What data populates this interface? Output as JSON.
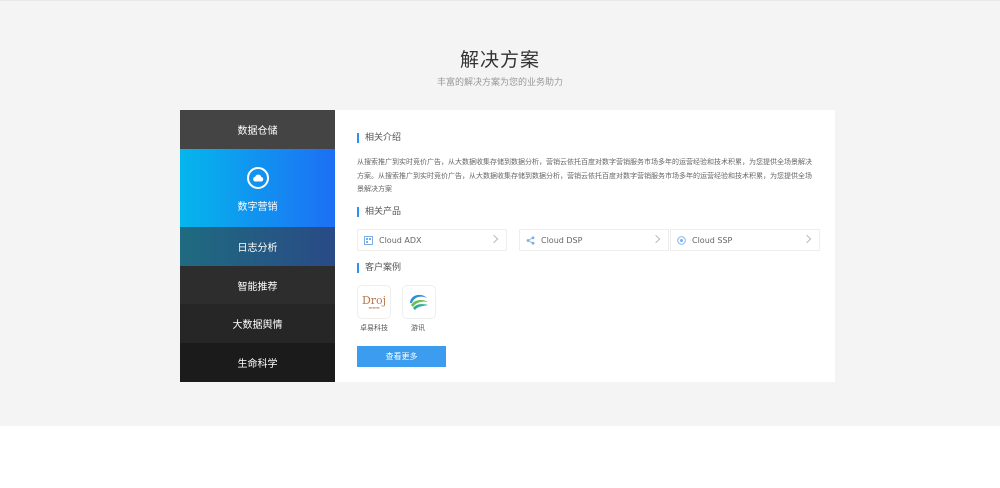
{
  "header": {
    "title": "解决方案",
    "subtitle": "丰富的解决方案为您的业务助力"
  },
  "menu": {
    "items": [
      {
        "label": "数据仓储"
      },
      {
        "label": "数字营销",
        "active": true,
        "icon": "cloud-icon"
      },
      {
        "label": "日志分析"
      },
      {
        "label": "智能推荐"
      },
      {
        "label": "大数据舆情"
      },
      {
        "label": "生命科学"
      }
    ]
  },
  "content": {
    "intro_heading": "相关介绍",
    "intro_text": "从搜索推广到实时竞价广告，从大数据收集存储到数据分析，营销云依托百度对数字营销服务市场多年的运营经验和技术积累，为您提供全场景解决方案。从搜索推广到实时竞价广告，从大数据收集存储到数据分析，营销云依托百度对数字营销服务市场多年的运营经验和技术积累，为您提供全场景解决方案",
    "products_heading": "相关产品",
    "products": [
      {
        "label": "Cloud ADX",
        "icon": "grid-icon"
      },
      {
        "label": "Cloud DSP",
        "icon": "share-icon"
      },
      {
        "label": "Cloud SSP",
        "icon": "target-icon"
      }
    ],
    "cases_heading": "客户案例",
    "cases": [
      {
        "label": "卓易科技",
        "logo_text": "Droj"
      },
      {
        "label": "游讯"
      }
    ],
    "more_button": "查看更多"
  },
  "colors": {
    "accent": "#3b9cf0",
    "active_gradient_start": "#05b6ec",
    "active_gradient_end": "#1d6ff5"
  }
}
